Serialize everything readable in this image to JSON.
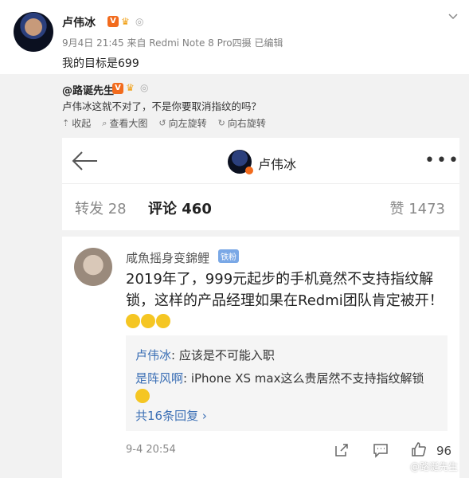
{
  "post": {
    "author": "卢伟冰",
    "meta": "9月4日 21:45 来自 Redmi Note 8 Pro四摄  已编辑",
    "text": "我的目标是699",
    "badge_v": "V"
  },
  "repost": {
    "user": "@路诞先生",
    "text": "卢伟冰这就不对了，不是你要取消指纹的吗？",
    "tools": [
      "收起",
      "查看大图",
      "向左旋转",
      "向右旋转"
    ]
  },
  "screenshot": {
    "name": "卢伟冰",
    "tabs": {
      "repost": "转发 28",
      "comment": "评论 460",
      "like": "赞 1473"
    },
    "comment": {
      "user": "咸魚摇身变錦鲤",
      "badge": "铁粉",
      "body": "2019年了，999元起步的手机竟然不支持指纹解锁，这样的产品经理如果在Redmi团队肯定被开！",
      "replies": [
        {
          "name": "卢伟冰",
          "text": ": 应该是不可能入职"
        },
        {
          "name": "是阵风啊",
          "text": ": iPhone XS max这么贵居然不支持指纹解锁"
        }
      ],
      "more": "共16条回复 ›",
      "time": "9-4 20:54",
      "likes": "96"
    },
    "watermark": "@路诞先生"
  }
}
